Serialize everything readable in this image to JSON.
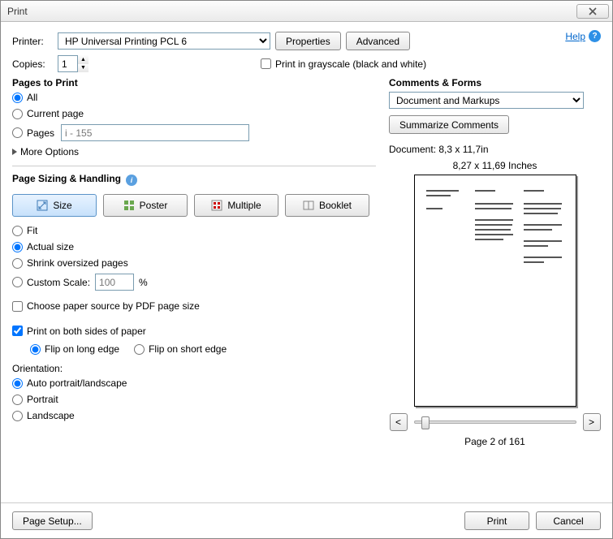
{
  "window": {
    "title": "Print"
  },
  "help": {
    "label": "Help"
  },
  "printer": {
    "label": "Printer:",
    "selected": "HP Universal Printing PCL 6",
    "properties": "Properties",
    "advanced": "Advanced"
  },
  "copies": {
    "label": "Copies:",
    "value": "1"
  },
  "grayscale": {
    "label": "Print in grayscale (black and white)",
    "checked": false
  },
  "pages_to_print": {
    "title": "Pages to Print",
    "all": "All",
    "current": "Current page",
    "pages_label": "Pages",
    "pages_value": "i - 155",
    "selected": "all",
    "more": "More Options"
  },
  "sizing": {
    "title": "Page Sizing & Handling",
    "tabs": {
      "size": "Size",
      "poster": "Poster",
      "multiple": "Multiple",
      "booklet": "Booklet"
    },
    "active_tab": "size",
    "fit": "Fit",
    "actual": "Actual size",
    "shrink": "Shrink oversized pages",
    "custom_label": "Custom Scale:",
    "custom_value": "100",
    "custom_unit": "%",
    "selected": "actual",
    "choose_source": "Choose paper source by PDF page size",
    "choose_source_checked": false
  },
  "duplex": {
    "label": "Print on both sides of paper",
    "checked": true,
    "long": "Flip on long edge",
    "short": "Flip on short edge",
    "selected": "long"
  },
  "orientation": {
    "title": "Orientation:",
    "auto": "Auto portrait/landscape",
    "portrait": "Portrait",
    "landscape": "Landscape",
    "selected": "auto"
  },
  "comments": {
    "title": "Comments & Forms",
    "selected": "Document and Markups",
    "summarize": "Summarize Comments"
  },
  "preview": {
    "doc_dim": "Document: 8,3 x 11,7in",
    "paper_dim": "8,27 x 11,69 Inches",
    "prev": "<",
    "next": ">",
    "page_status": "Page 2 of 161"
  },
  "footer": {
    "page_setup": "Page Setup...",
    "print": "Print",
    "cancel": "Cancel"
  }
}
